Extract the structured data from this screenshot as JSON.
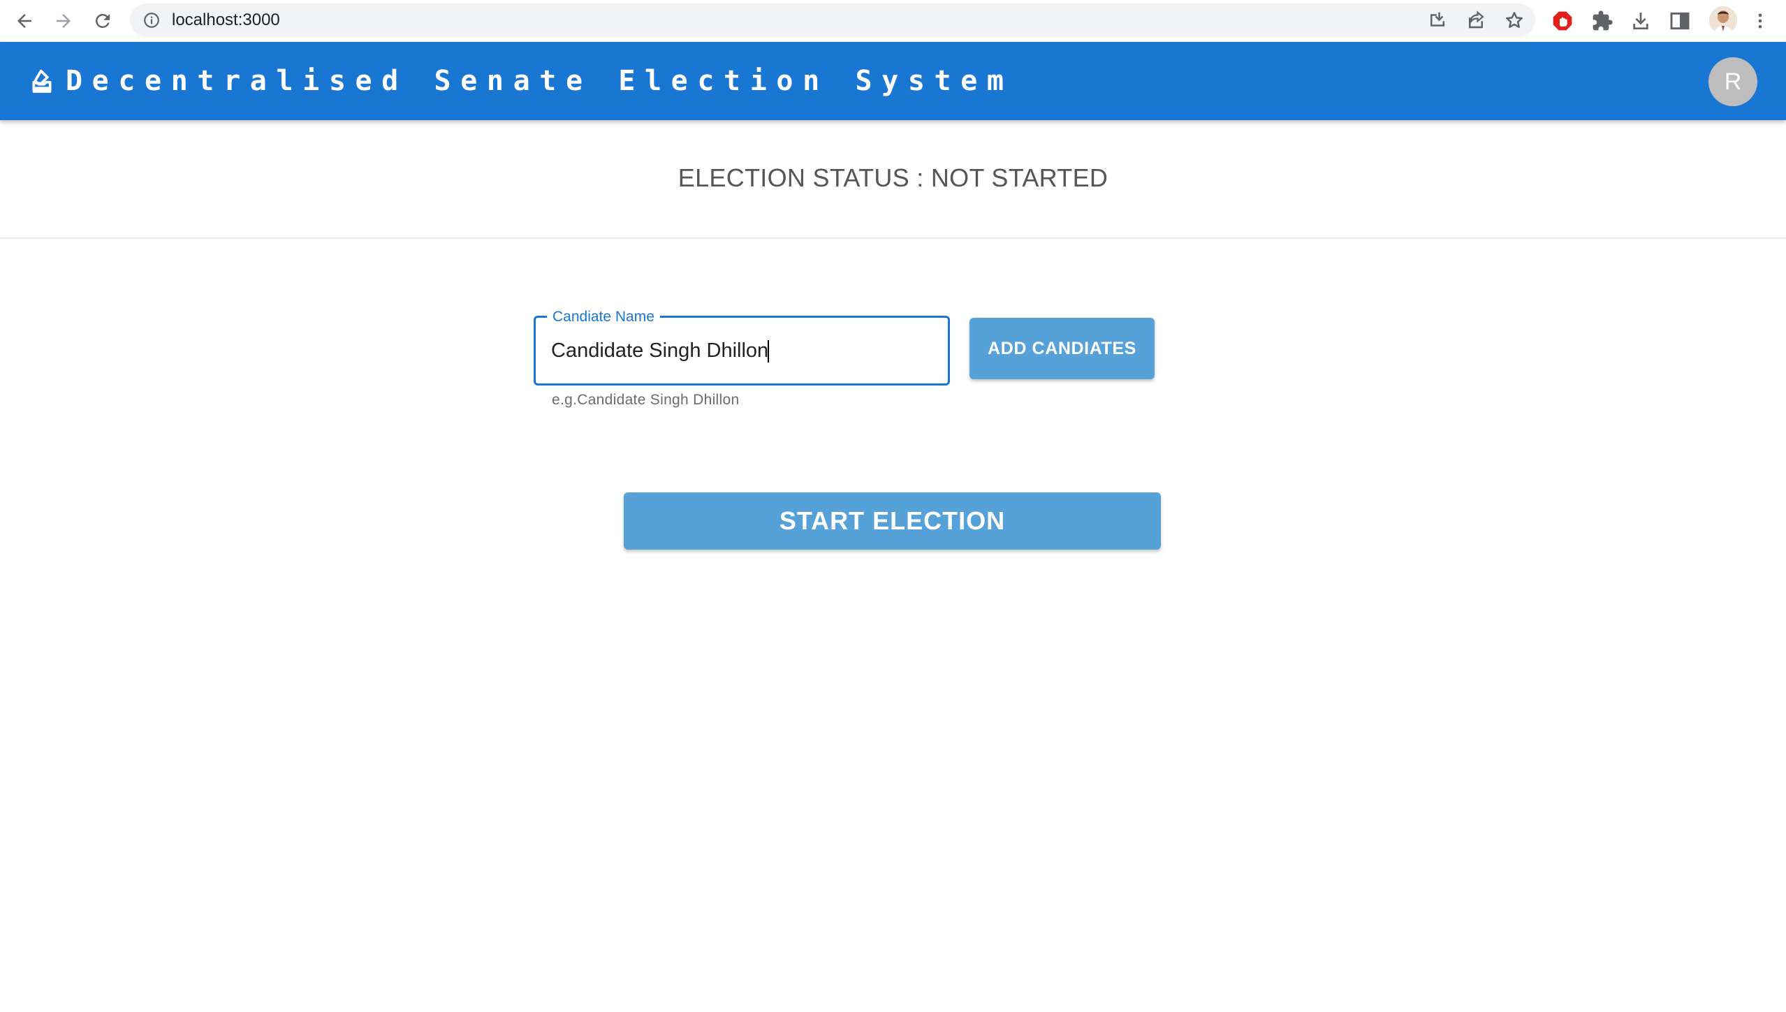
{
  "browser": {
    "url": "localhost:3000",
    "icons": [
      "back-arrow-icon",
      "forward-arrow-icon",
      "reload-icon",
      "site-info-icon",
      "install-app-icon",
      "share-icon",
      "bookmark-star-icon",
      "adblock-extension-icon",
      "extensions-puzzle-icon",
      "downloads-icon",
      "side-panel-icon",
      "profile-avatar",
      "more-menu-icon"
    ]
  },
  "header": {
    "title": "Decentralised Senate Election System",
    "avatar_letter": "R",
    "color": "#1976d2"
  },
  "status": {
    "text": "ELECTION STATUS : NOT STARTED"
  },
  "form": {
    "label": "Candiate Name",
    "value": "Candidate Singh Dhillon",
    "helper": "e.g.Candidate Singh Dhillon",
    "add_button": "ADD CANDIATES",
    "button_color": "#56a2d8"
  },
  "start_button": "START ELECTION"
}
